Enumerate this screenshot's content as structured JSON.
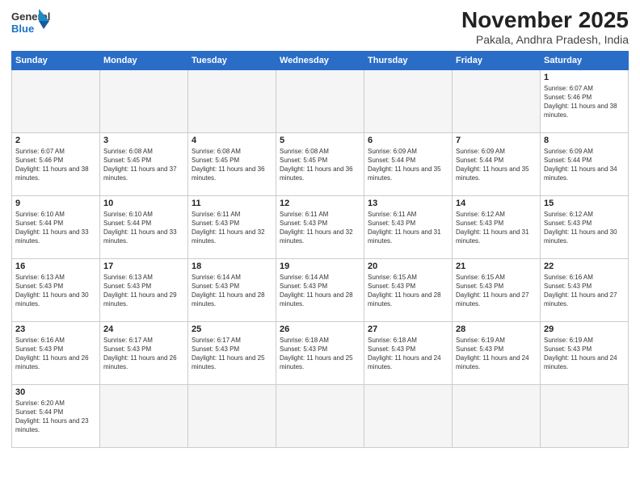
{
  "logo": {
    "general": "General",
    "blue": "Blue"
  },
  "header": {
    "month": "November 2025",
    "location": "Pakala, Andhra Pradesh, India"
  },
  "weekdays": [
    "Sunday",
    "Monday",
    "Tuesday",
    "Wednesday",
    "Thursday",
    "Friday",
    "Saturday"
  ],
  "days": [
    {
      "num": "",
      "sunrise": "",
      "sunset": "",
      "daylight": ""
    },
    {
      "num": "",
      "sunrise": "",
      "sunset": "",
      "daylight": ""
    },
    {
      "num": "",
      "sunrise": "",
      "sunset": "",
      "daylight": ""
    },
    {
      "num": "",
      "sunrise": "",
      "sunset": "",
      "daylight": ""
    },
    {
      "num": "",
      "sunrise": "",
      "sunset": "",
      "daylight": ""
    },
    {
      "num": "",
      "sunrise": "",
      "sunset": "",
      "daylight": ""
    },
    {
      "num": "1",
      "sunrise": "Sunrise: 6:07 AM",
      "sunset": "Sunset: 5:46 PM",
      "daylight": "Daylight: 11 hours and 38 minutes."
    },
    {
      "num": "2",
      "sunrise": "Sunrise: 6:07 AM",
      "sunset": "Sunset: 5:46 PM",
      "daylight": "Daylight: 11 hours and 38 minutes."
    },
    {
      "num": "3",
      "sunrise": "Sunrise: 6:08 AM",
      "sunset": "Sunset: 5:45 PM",
      "daylight": "Daylight: 11 hours and 37 minutes."
    },
    {
      "num": "4",
      "sunrise": "Sunrise: 6:08 AM",
      "sunset": "Sunset: 5:45 PM",
      "daylight": "Daylight: 11 hours and 36 minutes."
    },
    {
      "num": "5",
      "sunrise": "Sunrise: 6:08 AM",
      "sunset": "Sunset: 5:45 PM",
      "daylight": "Daylight: 11 hours and 36 minutes."
    },
    {
      "num": "6",
      "sunrise": "Sunrise: 6:09 AM",
      "sunset": "Sunset: 5:44 PM",
      "daylight": "Daylight: 11 hours and 35 minutes."
    },
    {
      "num": "7",
      "sunrise": "Sunrise: 6:09 AM",
      "sunset": "Sunset: 5:44 PM",
      "daylight": "Daylight: 11 hours and 35 minutes."
    },
    {
      "num": "8",
      "sunrise": "Sunrise: 6:09 AM",
      "sunset": "Sunset: 5:44 PM",
      "daylight": "Daylight: 11 hours and 34 minutes."
    },
    {
      "num": "9",
      "sunrise": "Sunrise: 6:10 AM",
      "sunset": "Sunset: 5:44 PM",
      "daylight": "Daylight: 11 hours and 33 minutes."
    },
    {
      "num": "10",
      "sunrise": "Sunrise: 6:10 AM",
      "sunset": "Sunset: 5:44 PM",
      "daylight": "Daylight: 11 hours and 33 minutes."
    },
    {
      "num": "11",
      "sunrise": "Sunrise: 6:11 AM",
      "sunset": "Sunset: 5:43 PM",
      "daylight": "Daylight: 11 hours and 32 minutes."
    },
    {
      "num": "12",
      "sunrise": "Sunrise: 6:11 AM",
      "sunset": "Sunset: 5:43 PM",
      "daylight": "Daylight: 11 hours and 32 minutes."
    },
    {
      "num": "13",
      "sunrise": "Sunrise: 6:11 AM",
      "sunset": "Sunset: 5:43 PM",
      "daylight": "Daylight: 11 hours and 31 minutes."
    },
    {
      "num": "14",
      "sunrise": "Sunrise: 6:12 AM",
      "sunset": "Sunset: 5:43 PM",
      "daylight": "Daylight: 11 hours and 31 minutes."
    },
    {
      "num": "15",
      "sunrise": "Sunrise: 6:12 AM",
      "sunset": "Sunset: 5:43 PM",
      "daylight": "Daylight: 11 hours and 30 minutes."
    },
    {
      "num": "16",
      "sunrise": "Sunrise: 6:13 AM",
      "sunset": "Sunset: 5:43 PM",
      "daylight": "Daylight: 11 hours and 30 minutes."
    },
    {
      "num": "17",
      "sunrise": "Sunrise: 6:13 AM",
      "sunset": "Sunset: 5:43 PM",
      "daylight": "Daylight: 11 hours and 29 minutes."
    },
    {
      "num": "18",
      "sunrise": "Sunrise: 6:14 AM",
      "sunset": "Sunset: 5:43 PM",
      "daylight": "Daylight: 11 hours and 28 minutes."
    },
    {
      "num": "19",
      "sunrise": "Sunrise: 6:14 AM",
      "sunset": "Sunset: 5:43 PM",
      "daylight": "Daylight: 11 hours and 28 minutes."
    },
    {
      "num": "20",
      "sunrise": "Sunrise: 6:15 AM",
      "sunset": "Sunset: 5:43 PM",
      "daylight": "Daylight: 11 hours and 28 minutes."
    },
    {
      "num": "21",
      "sunrise": "Sunrise: 6:15 AM",
      "sunset": "Sunset: 5:43 PM",
      "daylight": "Daylight: 11 hours and 27 minutes."
    },
    {
      "num": "22",
      "sunrise": "Sunrise: 6:16 AM",
      "sunset": "Sunset: 5:43 PM",
      "daylight": "Daylight: 11 hours and 27 minutes."
    },
    {
      "num": "23",
      "sunrise": "Sunrise: 6:16 AM",
      "sunset": "Sunset: 5:43 PM",
      "daylight": "Daylight: 11 hours and 26 minutes."
    },
    {
      "num": "24",
      "sunrise": "Sunrise: 6:17 AM",
      "sunset": "Sunset: 5:43 PM",
      "daylight": "Daylight: 11 hours and 26 minutes."
    },
    {
      "num": "25",
      "sunrise": "Sunrise: 6:17 AM",
      "sunset": "Sunset: 5:43 PM",
      "daylight": "Daylight: 11 hours and 25 minutes."
    },
    {
      "num": "26",
      "sunrise": "Sunrise: 6:18 AM",
      "sunset": "Sunset: 5:43 PM",
      "daylight": "Daylight: 11 hours and 25 minutes."
    },
    {
      "num": "27",
      "sunrise": "Sunrise: 6:18 AM",
      "sunset": "Sunset: 5:43 PM",
      "daylight": "Daylight: 11 hours and 24 minutes."
    },
    {
      "num": "28",
      "sunrise": "Sunrise: 6:19 AM",
      "sunset": "Sunset: 5:43 PM",
      "daylight": "Daylight: 11 hours and 24 minutes."
    },
    {
      "num": "29",
      "sunrise": "Sunrise: 6:19 AM",
      "sunset": "Sunset: 5:43 PM",
      "daylight": "Daylight: 11 hours and 24 minutes."
    },
    {
      "num": "30",
      "sunrise": "Sunrise: 6:20 AM",
      "sunset": "Sunset: 5:44 PM",
      "daylight": "Daylight: 11 hours and 23 minutes."
    }
  ]
}
